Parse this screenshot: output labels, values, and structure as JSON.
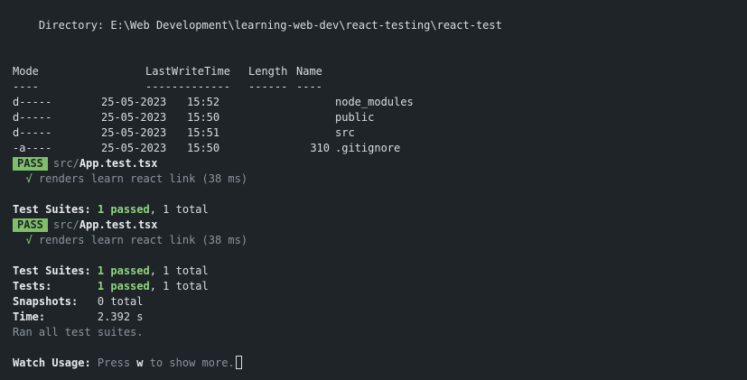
{
  "directory_line": "    Directory: E:\\Web Development\\learning-web-dev\\react-testing\\react-test",
  "listing": {
    "headers": {
      "mode": "Mode",
      "lastwrite": "LastWriteTime",
      "length": "Length",
      "name": "Name"
    },
    "underlines": {
      "mode": "----",
      "lastwrite": "-------------",
      "length": "------",
      "name": "----"
    },
    "rows": [
      {
        "mode": "d-----",
        "date": "25-05-2023",
        "time": "15:52",
        "length": "",
        "name": "node_modules"
      },
      {
        "mode": "d-----",
        "date": "25-05-2023",
        "time": "15:50",
        "length": "",
        "name": "public"
      },
      {
        "mode": "d-----",
        "date": "25-05-2023",
        "time": "15:51",
        "length": "",
        "name": "src"
      },
      {
        "mode": "-a----",
        "date": "25-05-2023",
        "time": "15:50",
        "length": "310",
        "name": ".gitignore"
      }
    ]
  },
  "run1": {
    "badge": "PASS",
    "file_dir": "src/",
    "file_name": "App.test.tsx",
    "check": "√",
    "test_desc": "renders learn react link (38 ms)",
    "suites_label": "Test Suites:",
    "suites_passed": "1 passed",
    "suites_total": ", 1 total"
  },
  "run2": {
    "badge": "PASS",
    "file_dir": "src/",
    "file_name": "App.test.tsx",
    "check": "√",
    "test_desc": "renders learn react link (38 ms)"
  },
  "summary": {
    "suites_label": "Test Suites: ",
    "suites_passed": "1 passed",
    "suites_total": ", 1 total",
    "tests_label": "Tests:       ",
    "tests_passed": "1 passed",
    "tests_total": ", 1 total",
    "snapshots_label": "Snapshots:   ",
    "snapshots_value": "0 total",
    "time_label": "Time:        ",
    "time_value": "2.392 s",
    "ran_all": "Ran all test suites."
  },
  "watch": {
    "label": "Watch Usage:",
    "press": " Press ",
    "key": "w",
    "rest": " to show more."
  }
}
